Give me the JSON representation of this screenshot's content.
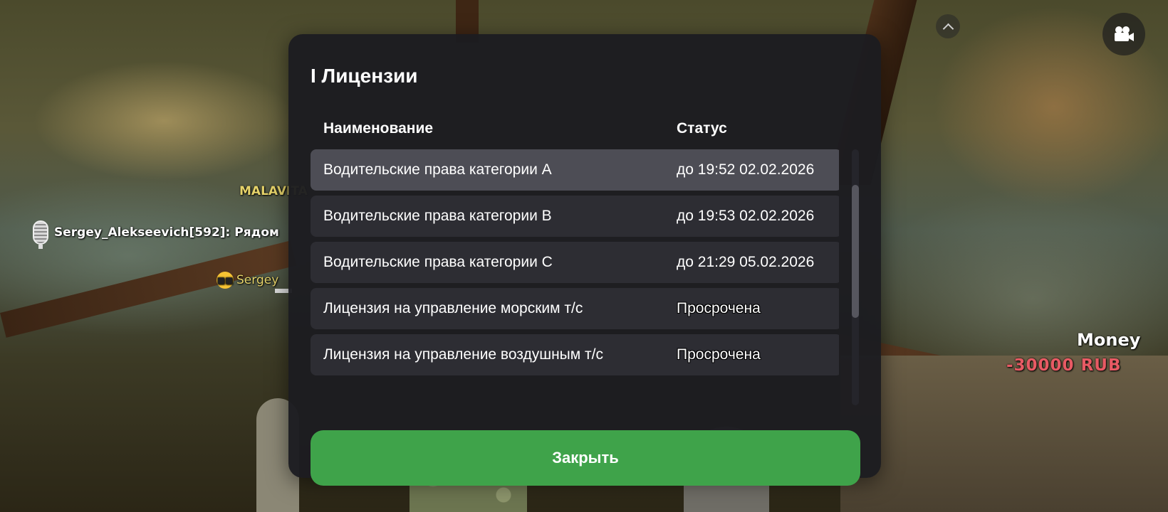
{
  "hud": {
    "nametag": "MALAVITA",
    "chat_message": "Sergey_Alekseevich[592]: Рядом",
    "player_name": "Sergey",
    "money_label": "Money",
    "money_value": "-30000 RUB",
    "chevron_icon": "chevron-up-icon",
    "camera_icon": "video-camera-icon",
    "mic_icon": "microphone-icon",
    "emote_icon": "sunglasses-emoji-icon"
  },
  "modal": {
    "title": "I Лицензии",
    "columns": {
      "name": "Наименование",
      "status": "Статус"
    },
    "licenses": [
      {
        "name": "Водительские права категории A",
        "status": "до 19:52 02.02.2026",
        "selected": true
      },
      {
        "name": "Водительские права категории B",
        "status": "до 19:53 02.02.2026"
      },
      {
        "name": "Водительские права категории C",
        "status": "до 21:29 05.02.2026"
      },
      {
        "name": "Лицензия на управление морским т/с",
        "status": "Просрочена"
      },
      {
        "name": "Лицензия на управление воздушным т/с",
        "status": "Просрочена"
      }
    ],
    "close_label": "Закрыть",
    "colors": {
      "panel": "#1c1c20",
      "row": "#2d2d33",
      "row_selected": "#4d4d55",
      "close_button": "#3fa34a",
      "money": "#e85a64",
      "nametag": "#e6d36a"
    }
  }
}
